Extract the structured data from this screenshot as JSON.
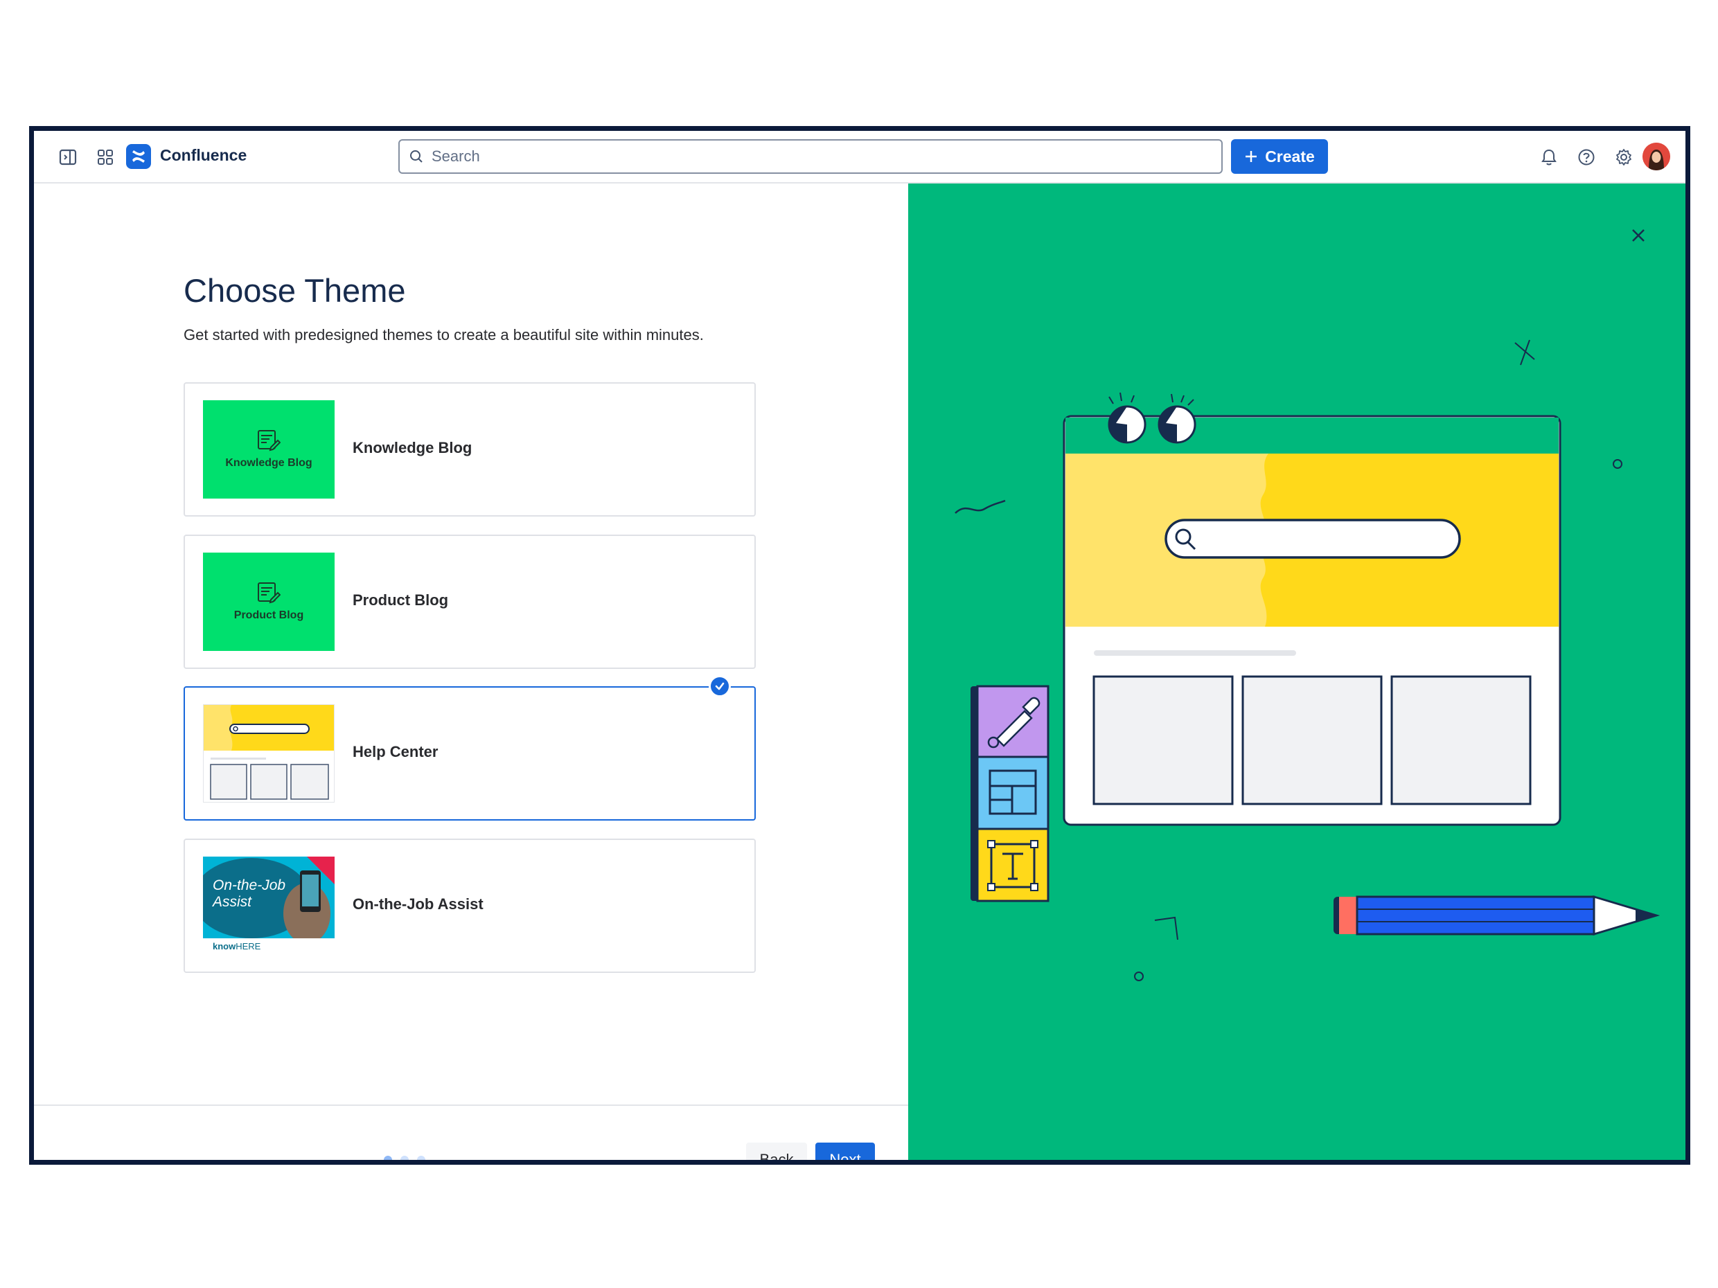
{
  "app": {
    "name": "Confluence"
  },
  "header": {
    "search_placeholder": "Search",
    "create_label": "Create"
  },
  "main": {
    "title": "Choose Theme",
    "subtitle": "Get started with predesigned themes to create a beautiful site within minutes.",
    "themes": [
      {
        "label": "Knowledge Blog",
        "thumb_label": "Knowledge Blog",
        "selected": false
      },
      {
        "label": "Product Blog",
        "thumb_label": "Product Blog",
        "selected": false
      },
      {
        "label": "Help Center",
        "selected": true
      },
      {
        "label": "On-the-Job Assist",
        "thumb_title": "On-the-Job Assist",
        "thumb_brand_strong": "know",
        "thumb_brand_rest": "HERE",
        "selected": false
      }
    ]
  },
  "footer": {
    "back_label": "Back",
    "next_label": "Next",
    "step_current": 1,
    "step_total": 3
  },
  "colors": {
    "accent": "#1868db",
    "illustration_bg": "#00b87c",
    "thumb_green": "#00e06e",
    "yellow": "#ffd91a"
  }
}
